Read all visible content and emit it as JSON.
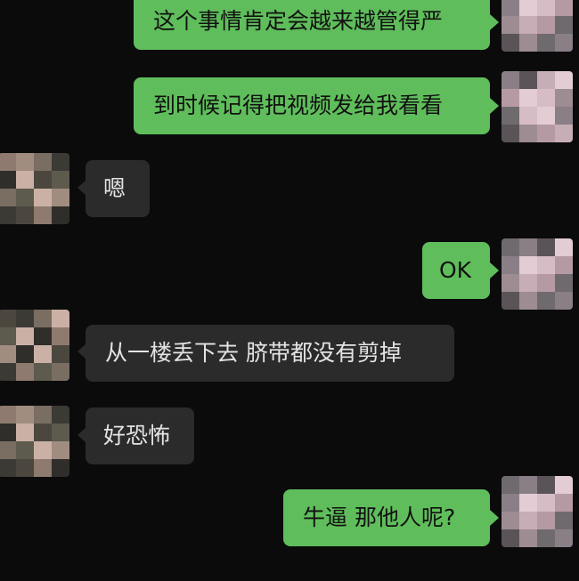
{
  "colors": {
    "background": "#0b0b0b",
    "outgoing_bubble": "#5fbe5b",
    "incoming_bubble": "#2b2b2b",
    "outgoing_text": "#121212",
    "incoming_text": "#e4e4e4"
  },
  "messages": [
    {
      "sender": "self",
      "text": "这个事情肯定会越来越管得严",
      "avatar_icon": "blurred-avatar-icon"
    },
    {
      "sender": "self",
      "text": "到时候记得把视频发给我看看",
      "avatar_icon": "blurred-avatar-icon"
    },
    {
      "sender": "other",
      "text": "嗯",
      "avatar_icon": "blurred-avatar-icon"
    },
    {
      "sender": "self",
      "text": "OK",
      "avatar_icon": "blurred-avatar-icon"
    },
    {
      "sender": "other",
      "text": "从一楼丢下去 脐带都没有剪掉",
      "avatar_icon": "blurred-avatar-icon"
    },
    {
      "sender": "other",
      "text": "好恐怖",
      "avatar_icon": "blurred-avatar-icon"
    },
    {
      "sender": "self",
      "text": "牛逼 那他人呢?",
      "avatar_icon": "blurred-avatar-icon"
    }
  ]
}
